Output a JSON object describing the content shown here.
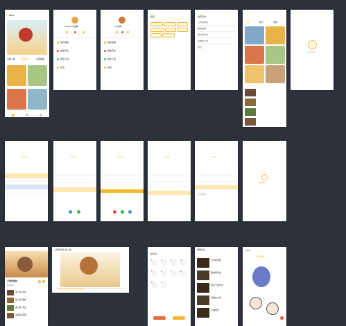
{
  "screens": {
    "home": {
      "title": "Story",
      "tabs": [
        "近期上新",
        "精选推荐",
        "全部故事"
      ],
      "cards": [
        "小熊的冒险",
        "森林音乐会",
        "星空下的约定",
        "勇敢的小兔"
      ],
      "nav": [
        "首页",
        "分类",
        "我的"
      ]
    },
    "profile1": {
      "name": "Storybook故事",
      "rows": [
        "我的收藏",
        "播放历史",
        "我的下载",
        "设置"
      ]
    },
    "profile2": {
      "name": "Lily妈妈",
      "rows": [
        "我的收藏",
        "播放历史",
        "我的下载",
        "设置"
      ]
    },
    "search": {
      "title": "搜索",
      "tags": [
        "小熊故事",
        "睡前故事",
        "童话",
        "寓言",
        "成语故事",
        "科普"
      ]
    },
    "history": {
      "title": "搜索历史",
      "items": [
        "小熊的冒险",
        "睡前故事",
        "森林音乐会",
        "勇敢的小兔",
        "星空"
      ]
    },
    "category": {
      "tabs": [
        "分类",
        "排行",
        "专题"
      ]
    },
    "empty": {
      "text": "暂无内容"
    },
    "login": {
      "brand": "Story",
      "btn": "登录",
      "register": "注册",
      "forgot": "忘记密码"
    },
    "loading": {
      "text": "加载中..."
    },
    "detail": {
      "title": "小熊的冒险",
      "sub": "故事简介",
      "list": [
        "第一集 出发",
        "第二集 森林",
        "第三集 河边",
        "第四集 回家"
      ]
    },
    "player": {
      "title": "小熊的冒险 第一集"
    },
    "keypad": {
      "title": "验证码",
      "keys": [
        "1",
        "2",
        "3",
        "4",
        "5",
        "6",
        "7",
        "8",
        "9",
        "0"
      ]
    },
    "videos": {
      "title": "视频列表",
      "items": [
        "小熊的冒险",
        "森林音乐会",
        "星空下的约定",
        "勇敢的小兔",
        "小猪佩奇"
      ]
    },
    "cover": {
      "title": "Story",
      "tab": "热门推荐"
    }
  },
  "colors": {
    "accent": "#f7b733",
    "bg": "#2d3139"
  }
}
